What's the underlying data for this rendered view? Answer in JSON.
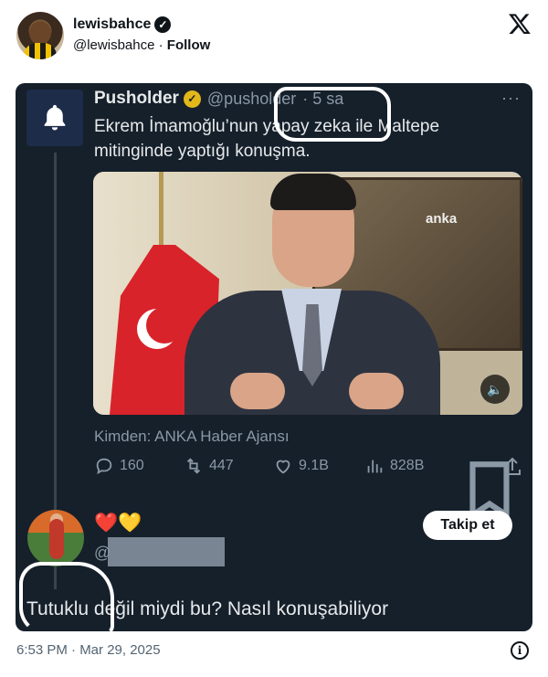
{
  "post": {
    "display_name": "lewisbahce",
    "handle": "@lewisbahce",
    "separator": "·",
    "follow_label": "Follow",
    "timestamp": "6:53 PM · Mar 29, 2025"
  },
  "embedded": {
    "author_name": "Pusholder",
    "author_handle": "@pusholder",
    "age": "· 5 sa",
    "more_label": "···",
    "text": "Ekrem İmamoğlu’nun yapay zeka ile Maltepe mitinginde yaptığı konuşma.",
    "watermark": "anka",
    "from_label": "Kimden: ANKA Haber Ajansı",
    "stats": {
      "replies": "160",
      "reposts": "447",
      "likes": "9.1B",
      "views": "828B"
    },
    "reply": {
      "emojis": "❤️💛",
      "handle_prefix": "@",
      "follow_label": "Takip et",
      "text": "Tutuklu değil miydi bu? Nasıl konuşabiliyor"
    }
  },
  "icons": {
    "x_logo": "x-logo-icon",
    "bell": "bell-icon",
    "verified": "verified-badge-icon",
    "info": "info-icon"
  },
  "colors": {
    "dark_bg": "#15202b",
    "gold_badge": "#e2b719",
    "muted": "#8b98a5",
    "text_light": "#e7e9ea"
  }
}
